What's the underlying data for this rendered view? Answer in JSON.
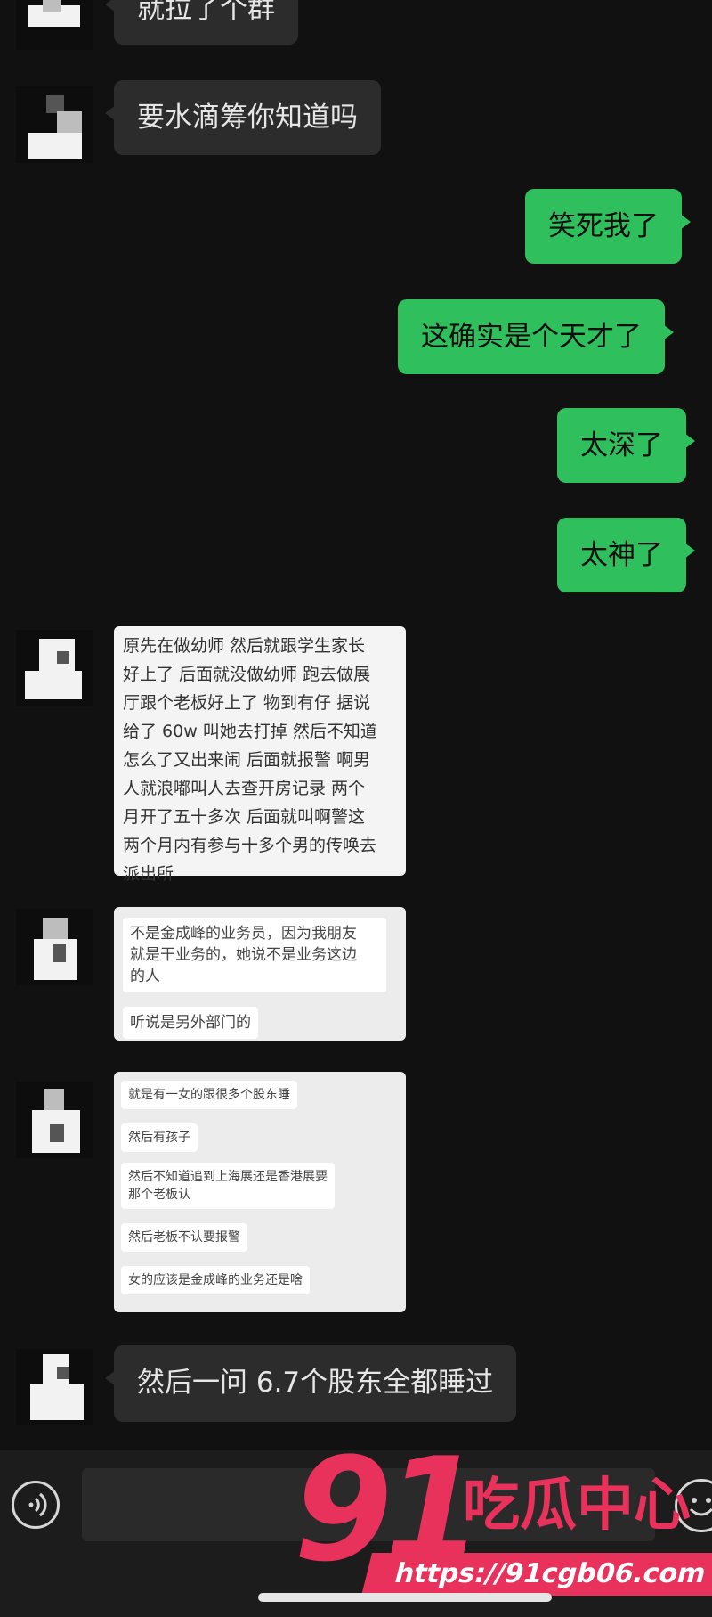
{
  "messages": [
    {
      "side": "left",
      "text": "就拉了个群"
    },
    {
      "side": "left",
      "text": "要水滴筹你知道吗"
    },
    {
      "side": "right",
      "text": "笑死我了"
    },
    {
      "side": "right",
      "text": "这确实是个天才了"
    },
    {
      "side": "right",
      "text": "太深了"
    },
    {
      "side": "right",
      "text": "太神了"
    },
    {
      "side": "left",
      "type": "image",
      "lines": [
        "原先在做幼师 然后就跟学生家长",
        "好上了 后面就没做幼师 跑去做展",
        "厅跟个老板好上了 物到有仔 据说",
        "给了 60w 叫她去打掉 然后不知道",
        "怎么了又出来闹 后面就报警 啊男",
        "人就浪嘟叫人去查开房记录 两个",
        "月开了五十多次 后面就叫啊警这",
        "两个月内有参与十多个男的传唤去",
        "派出所"
      ]
    },
    {
      "side": "left",
      "type": "image",
      "bubbles": [
        "不是金成峰的业务员，因为我朋友\n就是干业务的，她说不是业务这边\n的人",
        "听说是另外部门的"
      ]
    },
    {
      "side": "left",
      "type": "image",
      "bubbles": [
        "就是有一女的跟很多个股东睡",
        "然后有孩子",
        "然后不知道追到上海展还是香港展要\n那个老板认",
        "然后老板不认要报警",
        "女的应该是金成峰的业务还是啥"
      ]
    },
    {
      "side": "left",
      "text": "然后一问 6.7个股东全都睡过"
    }
  ],
  "input": {
    "placeholder": ""
  },
  "icons": {
    "voice": "voice-wave-icon",
    "emoji": "smiley-icon"
  },
  "watermark": {
    "number": "91",
    "text": "吃瓜中心",
    "url": "https://91cgb06.com"
  },
  "colors": {
    "background": "#111111",
    "outgoing": "#2fc05d",
    "incoming": "#2c2c2c",
    "watermark": "#e8315b"
  }
}
